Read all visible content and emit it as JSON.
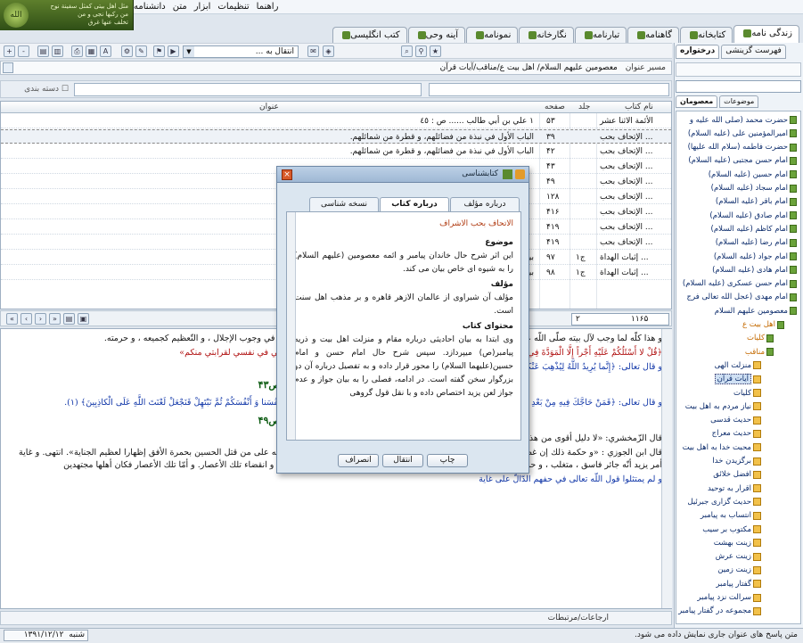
{
  "banner": {
    "lines": [
      "مثل اهل بیتی کمثل سفینة نوح",
      "من رکبها نجی و من",
      "تخلف عنها غرق"
    ],
    "logo": "الله"
  },
  "menu": [
    "دانشنامه",
    "متن",
    "ابزار",
    "تنظیمات",
    "راهنما"
  ],
  "top_tabs": [
    {
      "label": "زندگی نامه",
      "active": true
    },
    {
      "label": "کتابخانه"
    },
    {
      "label": "گاهنامه"
    },
    {
      "label": "تبارنامه"
    },
    {
      "label": "نگارخانه"
    },
    {
      "label": "نمونامه"
    },
    {
      "label": "آینه وحی"
    },
    {
      "label": "کتب انگلیسی"
    }
  ],
  "toolbar": {
    "transfer_combo": "انتقال به ..."
  },
  "path": {
    "label": "مسیر عنوان",
    "value": "معصومین علیهم السلام/ اهل بیت ع/مناقب/آیات قرآن"
  },
  "filter": {
    "category_checkbox": "دسته بندی"
  },
  "grid": {
    "headers": {
      "book": "نام کتاب",
      "volume": "جلد",
      "page": "صفحه",
      "title": "عنوان"
    },
    "rows": [
      {
        "book": "الأئمة الاثنا عشر",
        "vol": "",
        "page": "۵۳",
        "title": "١ علي بن أبي طالب ...... ص : ٤٥"
      },
      {
        "book": "الإتحاف بحب ...",
        "vol": "",
        "page": "۳۹",
        "title": "الباب الأول في نبذة من فضائلهم، و قطرة من شمائلهم.",
        "selected": true
      },
      {
        "book": "الإتحاف بحب ...",
        "vol": "",
        "page": "۴۲",
        "title": "الباب الأول في نبذة من فضائلهم، و قطرة من شمائلهم."
      },
      {
        "book": "الإتحاف بحب ...",
        "vol": "",
        "page": "۴۳",
        "title": ""
      },
      {
        "book": "الإتحاف بحب ...",
        "vol": "",
        "page": "۴۹",
        "title": ""
      },
      {
        "book": "الإتحاف بحب ...",
        "vol": "",
        "page": "۱۲۸",
        "title": ""
      },
      {
        "book": "الإتحاف بحب ...",
        "vol": "",
        "page": "۴۱۶",
        "title": ""
      },
      {
        "book": "الإتحاف بحب ...",
        "vol": "",
        "page": "۴۱۹",
        "title": ""
      },
      {
        "book": "الإتحاف بحب ...",
        "vol": "",
        "page": "۴۱۹",
        "title": ""
      },
      {
        "book": "إثبات الهداة ...",
        "vol": "ج۱",
        "page": "۹۷",
        "title": "بياء و الأئمة ..... ص : ۹۷"
      },
      {
        "book": "إثبات الهداة ...",
        "vol": "ج۱",
        "page": "۹۸",
        "title": "بياء و الأئمة ..... ص : ۹۷"
      }
    ]
  },
  "nav": {
    "page_total": "١١۶۵",
    "page_current": "۲"
  },
  "text": {
    "p1": "و هذا كلّه لما وجب لآل بيته صلّى اللّه عليه و سلّم ، و سريان لحمه ، و دمه الكريمين فيهم ، فهم بعضه ، و بعضه في وجوب الإجلال ، و التّعظيم كجميعه ، و حرمته.",
    "p2": "﴿قُلْ لا أَسْئَلُكُمْ عَلَيْهِ أَجْراً إِلَّا الْمَوَدَّةَ فِي الْقُرْبى﴾ [۳۱]، قال ابن عباس: «المعنى لا أسألكم عليه أجرا إلّا أن تودّوني في نفسي لقرابتي منكم»",
    "p3": "و قال تعالى: ﴿إِنَّما يُرِيدُ اللَّهُ لِيُذْهِبَ عَنْكُمُ الرِّجْسَ أَهْلَ الْبَيْتِ﴾",
    "h1": "الإتحاف بحب الأشراف، الشبراوي :ص۴۳",
    "p4": "و قال تعالى: ﴿فَمَنْ حَاجَّكَ فِيهِ مِنْ بَعْدِ ما جاءَكَ مِنَ الْعِلْمِ فَقُلْ تَعالَوْا نَدْعُ أَبْناءَنا وَ أَبْناءَكُمْ وَ نِساءَنا وَ نِساءَكُمْ وَ أَنْفُسَنا وَ أَنْفُسَكُمْ ثُمَّ نَبْتَهِلْ فَنَجْعَلْ لَعْنَتَ اللَّهِ عَلَى الْكاذِبِينَ﴾ (۱).",
    "h2": "الإتحاف بحب الأشراف، الشبراوي :ص۴۹",
    "p5": "قال الزّمخشري: «لا دليل أقوى من هذا على فضل أصحاب الكساء»، و هم :",
    "p6": "قال ابن الجوزي : «و حكمة ذلك إن غضبنا يؤثر حمرة الوجه، و الحق سبحانه تنزه عن الجسمية فأظهر تأثير غضبه على من قتل الحسين بحمرة الأفق إظهارا لعظيم الجناية». انتهى. و غاية أمر يزيد أنّه جائر فاسق ، متغلب ، و حرمة الخروج على الجائر الّتي حكي عليها الإجماع محلها بعد استقرار الأمور و انقضاء تلك الأعصار. و أمّا تلك الأعصار فكان أهلها مجتهدين",
    "p7": "و لم يمتثلوا قول اللّه تعالى في حفهم الدّالّ على غاية"
  },
  "refbar": "ارجاعات/مرتبطات",
  "status": {
    "message": "متن پاسخ های عنوان جاری نمایش داده می شود.",
    "day": "شنبه",
    "date": "۱۳۹۱/۱۲/۱۲"
  },
  "rpanel": {
    "tabs": [
      "درختواره",
      "فهرست گزینشی"
    ],
    "header": "",
    "tabs2": [
      "معصومان",
      "موضوعات"
    ],
    "tree": [
      {
        "label": "حضرت محمد (صلی الله علیه و",
        "type": "person",
        "level": 0
      },
      {
        "label": "امیرالمؤمنین علی (علیه السلام)",
        "type": "person",
        "level": 0
      },
      {
        "label": "حضرت فاطمه (سلام الله علیها)",
        "type": "person",
        "level": 0
      },
      {
        "label": "امام حسن مجتبی (علیه السلام)",
        "type": "person",
        "level": 0
      },
      {
        "label": "امام حسین (علیه السلام)",
        "type": "person",
        "level": 0
      },
      {
        "label": "امام سجاد (علیه السلام)",
        "type": "person",
        "level": 0
      },
      {
        "label": "امام باقر (علیه السلام)",
        "type": "person",
        "level": 0
      },
      {
        "label": "امام صادق (علیه السلام)",
        "type": "person",
        "level": 0
      },
      {
        "label": "امام کاظم (علیه السلام)",
        "type": "person",
        "level": 0
      },
      {
        "label": "امام رضا (علیه السلام)",
        "type": "person",
        "level": 0
      },
      {
        "label": "امام جواد (علیه السلام)",
        "type": "person",
        "level": 0
      },
      {
        "label": "امام هادی (علیه السلام)",
        "type": "person",
        "level": 0
      },
      {
        "label": "امام حسن عسکری (علیه السلام)",
        "type": "person",
        "level": 0
      },
      {
        "label": "امام مهدی (عجل الله تعالی فرج",
        "type": "person",
        "level": 0
      },
      {
        "label": "معصومین علیهم السلام",
        "type": "person",
        "level": 0
      },
      {
        "label": "اهل بیت ع",
        "type": "folder",
        "level": 1,
        "orange": true
      },
      {
        "label": "کلیات",
        "type": "folder",
        "level": 2,
        "orange": true
      },
      {
        "label": "مناقب",
        "type": "folder",
        "level": 2,
        "orange": true
      },
      {
        "label": "منزلت الهی",
        "type": "book",
        "level": 3
      },
      {
        "label": "آیات قرآن",
        "type": "book",
        "level": 3,
        "highlight": true
      },
      {
        "label": "کلیات",
        "type": "book",
        "level": 3
      },
      {
        "label": "نیاز مردم به اهل بیت",
        "type": "book",
        "level": 3
      },
      {
        "label": "حدیث قدسی",
        "type": "book",
        "level": 3
      },
      {
        "label": "حدیث معراج",
        "type": "book",
        "level": 3
      },
      {
        "label": "محبت خدا به اهل بیت",
        "type": "book",
        "level": 3
      },
      {
        "label": "برگزیدن خدا",
        "type": "book",
        "level": 3
      },
      {
        "label": "افضل خلائق",
        "type": "book",
        "level": 3
      },
      {
        "label": "اقرار به توحید",
        "type": "book",
        "level": 3
      },
      {
        "label": "حدیث گزاری جبرئیل",
        "type": "book",
        "level": 3
      },
      {
        "label": "انتساب به پیامبر",
        "type": "book",
        "level": 3
      },
      {
        "label": "مکتوب بر سیب",
        "type": "book",
        "level": 3
      },
      {
        "label": "زینت بهشت",
        "type": "book",
        "level": 3
      },
      {
        "label": "زینت عرش",
        "type": "book",
        "level": 3
      },
      {
        "label": "زینت زمین",
        "type": "book",
        "level": 3
      },
      {
        "label": "گفتار پیامبر",
        "type": "book",
        "level": 3
      },
      {
        "label": "سرالت نزد پیامبر",
        "type": "book",
        "level": 3
      },
      {
        "label": "مجموعه در گفتار پیامبر",
        "type": "book",
        "level": 3
      }
    ]
  },
  "dialog": {
    "title": "کتابشناسی",
    "tabs": [
      "نسخه شناسی",
      "درباره کتاب",
      "درباره مؤلف"
    ],
    "book_title": "الاتحاف بحب الاشراف",
    "sections": [
      {
        "head": "موضوع",
        "body": "این اثر شرح حال خاندان پیامبر و ائمه معصومین (علیهم السلام) را به شیوه ای خاص بیان می کند."
      },
      {
        "head": "مؤلف",
        "body": "مؤلف آن شبراوی از عالمان الازهر قاهره و بر مذهب اهل سنت است."
      },
      {
        "head": "محتوای کتاب",
        "body": "وی ابتدا به بیان احادیثی درباره مقام و منزلت اهل بیت و ذریه پیامبر(ص) میپردازد. سپس شرح حال امام حسن و امام حسین(علیهما السلام) را محور قرار داده و به تفصیل درباره آن دو بزرگوار سخن گفته است. در ادامه، فصلی را به بیان جواز و عدم جواز لعن یزید اختصاص داده و با نقل قول گروهی"
      }
    ],
    "buttons": {
      "print": "چاپ",
      "transfer": "انتقال",
      "cancel": "انصراف"
    }
  }
}
